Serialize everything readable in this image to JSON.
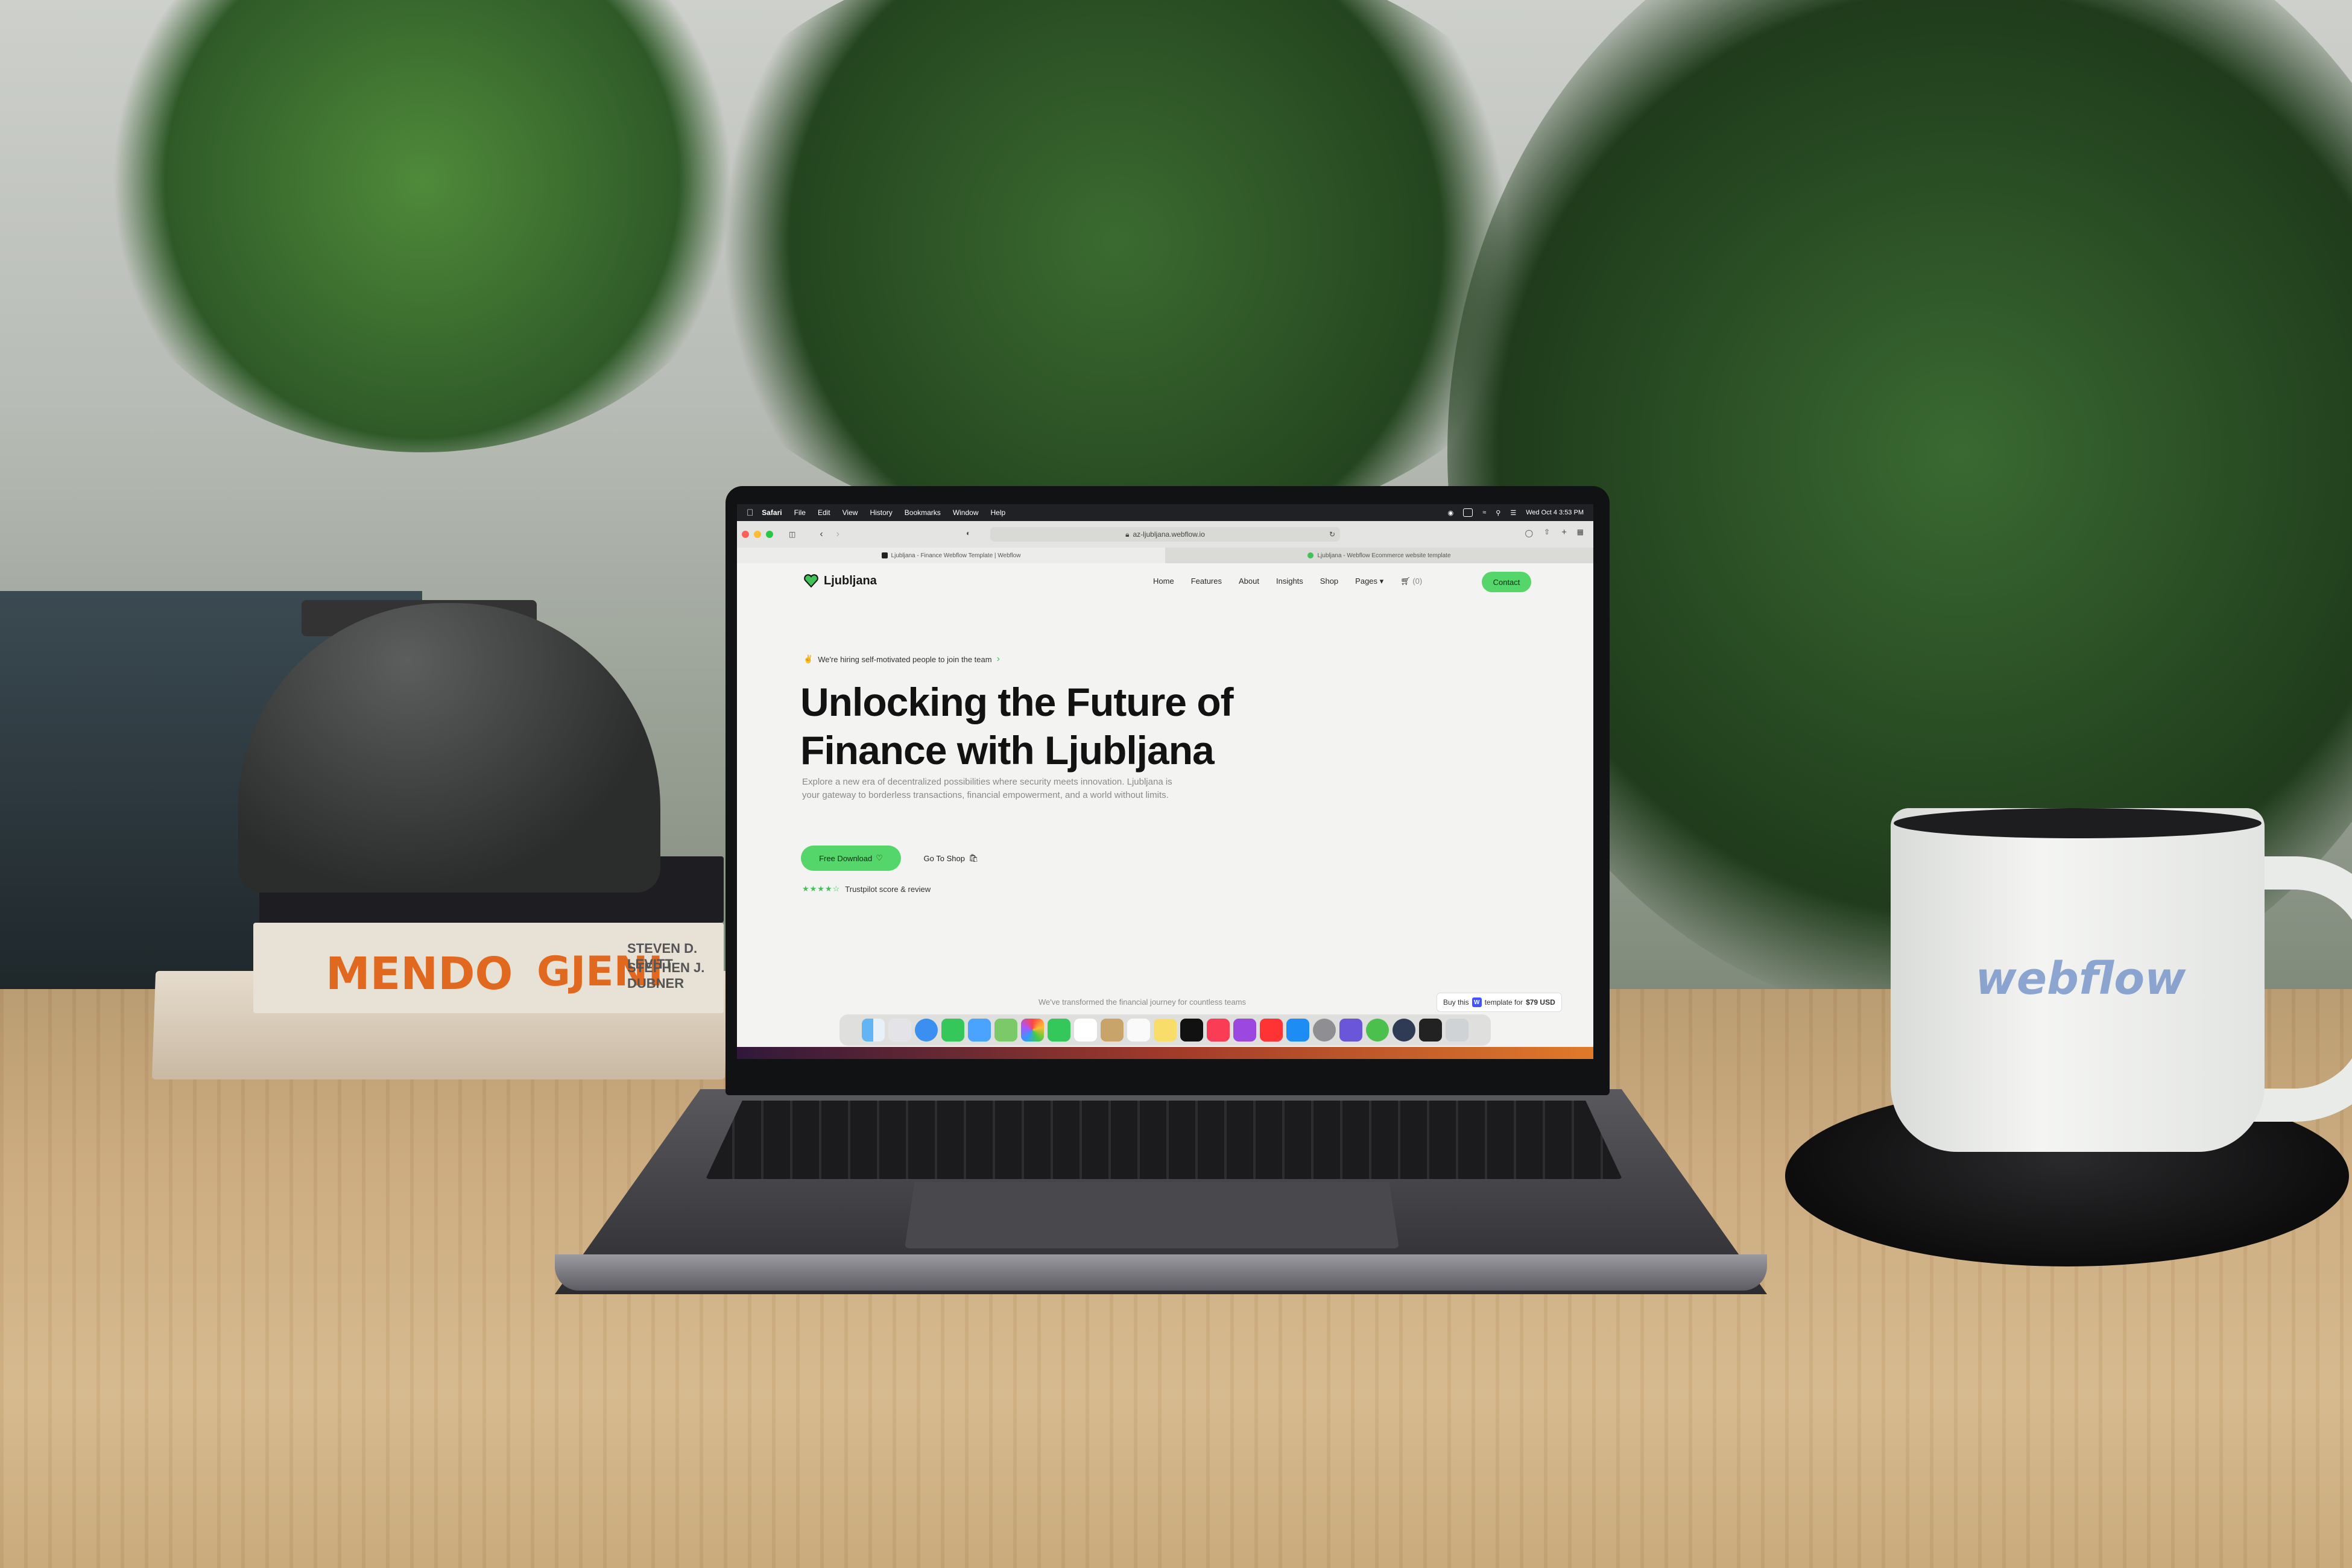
{
  "menubar": {
    "app_name": "Safari",
    "menus": [
      "File",
      "Edit",
      "View",
      "History",
      "Bookmarks",
      "Window",
      "Help"
    ],
    "clock": "Wed Oct 4  3:53 PM"
  },
  "browser": {
    "url": "az-ljubljana.webflow.io",
    "tabs": [
      {
        "title": "Ljubljana - Finance Webflow Template | Webflow",
        "favicon_color": "#222222"
      },
      {
        "title": "Ljubljana - Webflow Ecommerce website template",
        "favicon_color": "#3fc257"
      }
    ]
  },
  "site": {
    "logo_text": "Ljubljana",
    "nav": [
      "Home",
      "Features",
      "About",
      "Insights",
      "Shop",
      "Pages"
    ],
    "cart_label": "(0)",
    "contact_label": "Contact",
    "hiring_text": "We're hiring self-motivated people to join the team",
    "headline_line1": "Unlocking the Future of",
    "headline_line2": "Finance with Ljubljana",
    "subtext": "Explore a new era of decentralized possibilities where security meets innovation. Ljubljana is your gateway to borderless transactions, financial empowerment, and a world without limits.",
    "download_label": "Free Download",
    "shop_label": "Go To Shop",
    "stars": "★★★★☆",
    "rating_text": "Trustpilot score & review",
    "footer_text": "We've transformed the financial journey for countless teams",
    "buy_prefix": "Buy this",
    "buy_middle": "template for",
    "buy_price": "$79 USD"
  },
  "scene": {
    "books": [
      "MENDO",
      "GJENI",
      "STEVEN D. LEVITT",
      "STEPHEN J. DUBNER"
    ],
    "mug_logo": "webflow"
  },
  "colors": {
    "accent_green": "#55d66a",
    "webflow_blue": "#4353ff"
  }
}
